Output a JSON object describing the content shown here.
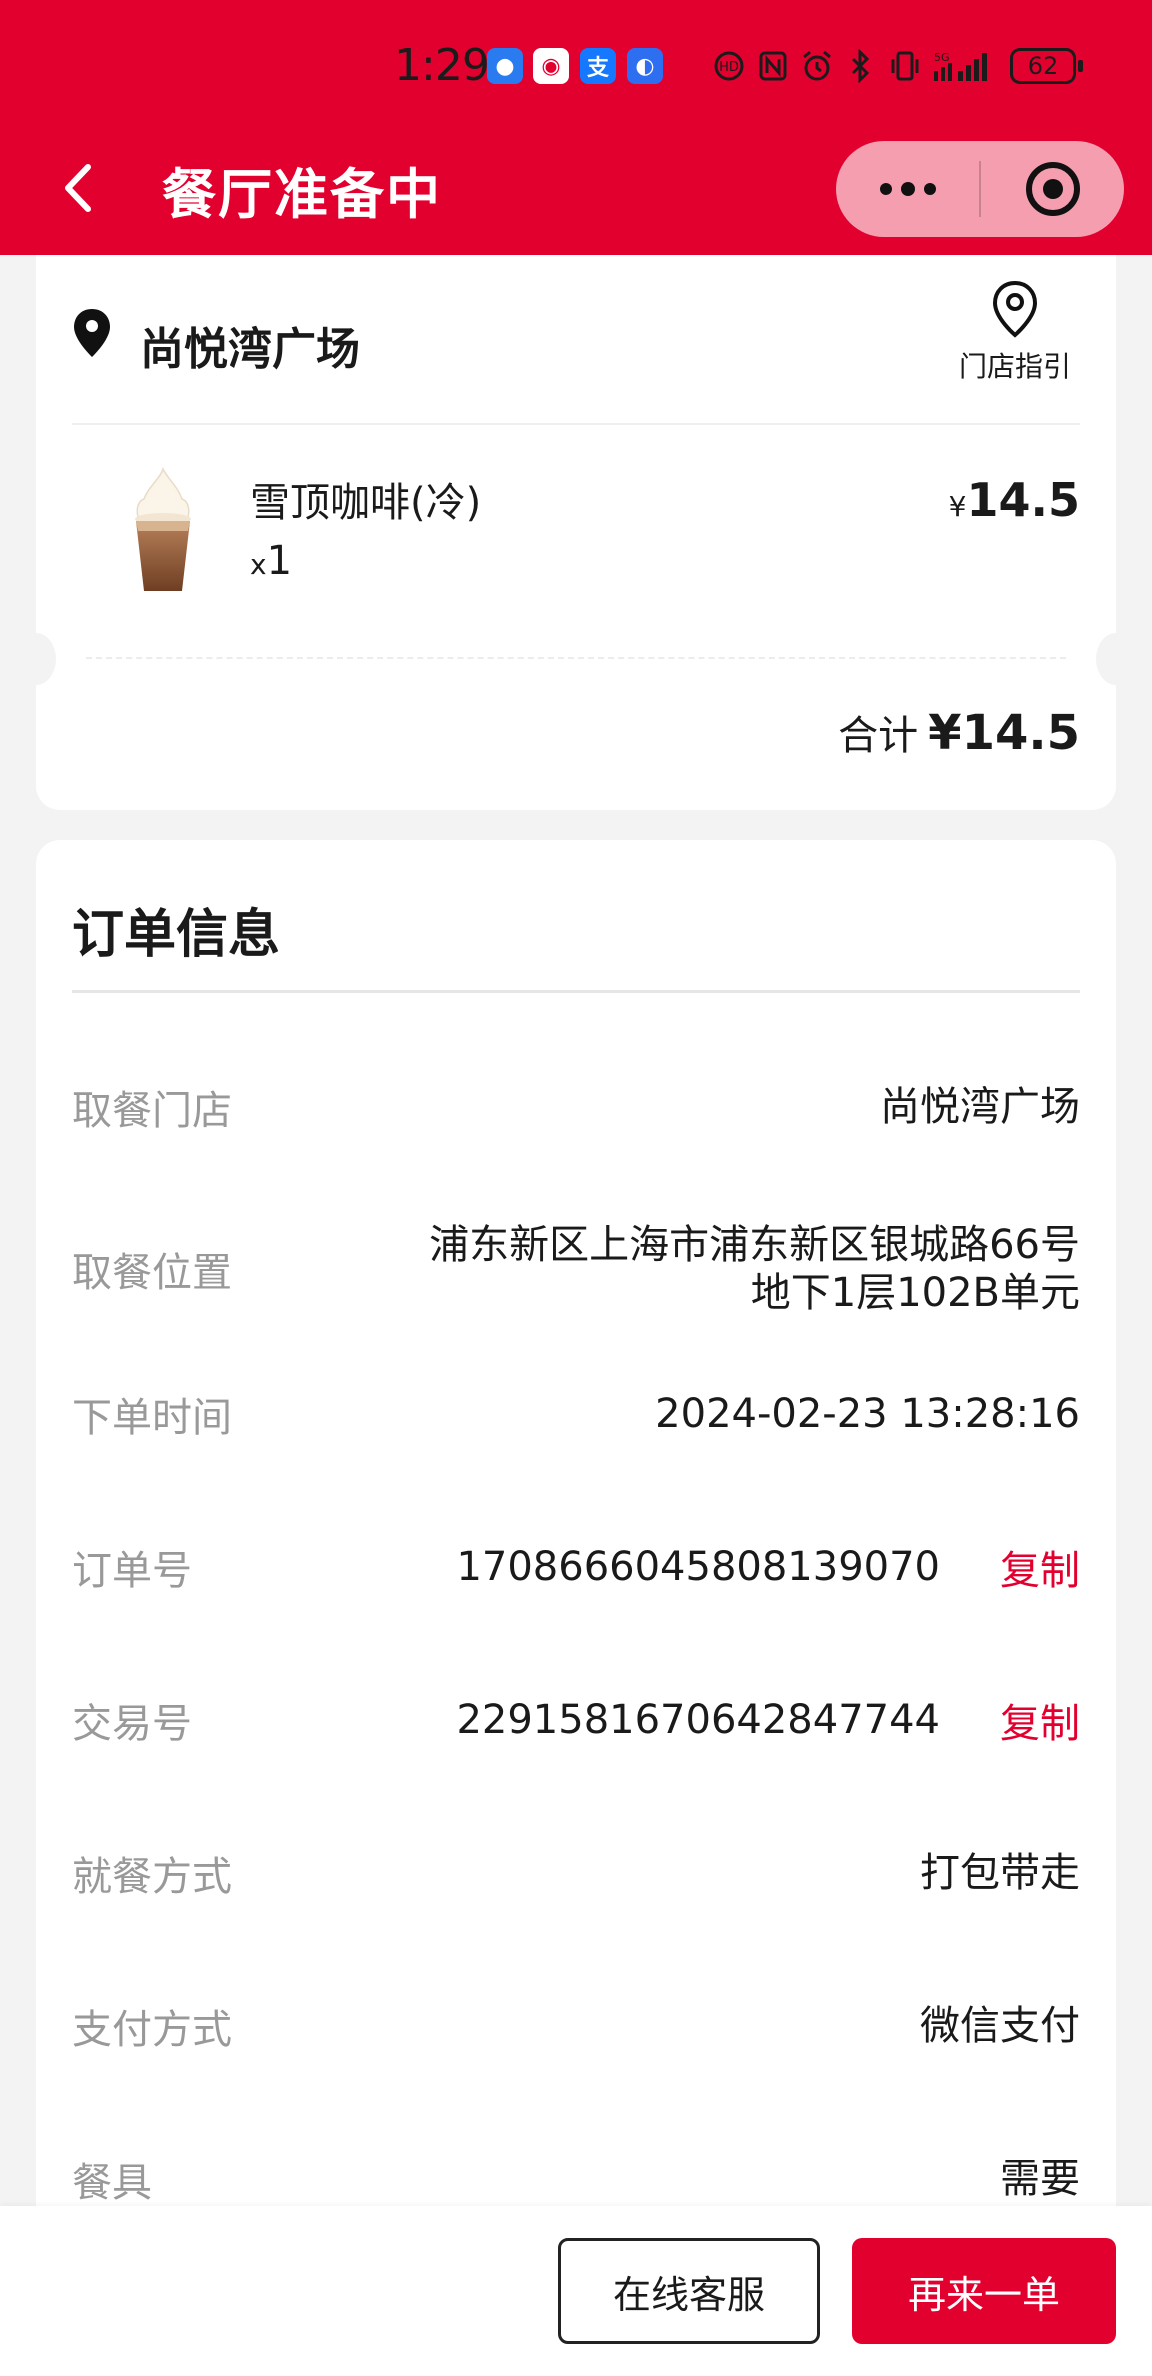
{
  "status_bar": {
    "time": "1:29",
    "battery": "62",
    "network": "5G",
    "app_icons": [
      "app-notification-1",
      "app-notification-2",
      "alipay-icon",
      "app-notification-4"
    ]
  },
  "header": {
    "title": "餐厅准备中",
    "back_icon": "chevron-left-icon",
    "more_icon": "more-dots-icon",
    "close_icon": "target-close-icon",
    "background_color": "#e2002f"
  },
  "order": {
    "store_name": "尚悦湾广场",
    "store_guide_label": "门店指引",
    "item": {
      "name": "雪顶咖啡(冷)",
      "qty_prefix": "x",
      "qty": "1",
      "currency": "¥",
      "price": "14.5"
    },
    "total_label": "合计",
    "total_amount": "¥14.5"
  },
  "info": {
    "title": "订单信息",
    "rows": [
      {
        "label": "取餐门店",
        "value": "尚悦湾广场"
      },
      {
        "label": "取餐位置",
        "value_line1": "浦东新区上海市浦东新区银城路66号",
        "value_line2": "地下1层102B单元"
      },
      {
        "label": "下单时间",
        "value": "2024-02-23 13:28:16"
      },
      {
        "label": "订单号",
        "value": "1708666045808139070",
        "action": "复制"
      },
      {
        "label": "交易号",
        "value": "2291581670642847744",
        "action": "复制"
      },
      {
        "label": "就餐方式",
        "value": "打包带走"
      },
      {
        "label": "支付方式",
        "value": "微信支付"
      },
      {
        "label": "餐具",
        "value": "需要"
      }
    ]
  },
  "actions": {
    "service_label": "在线客服",
    "reorder_label": "再来一单"
  },
  "colors": {
    "accent": "#e2002f",
    "label_gray": "#999999"
  }
}
